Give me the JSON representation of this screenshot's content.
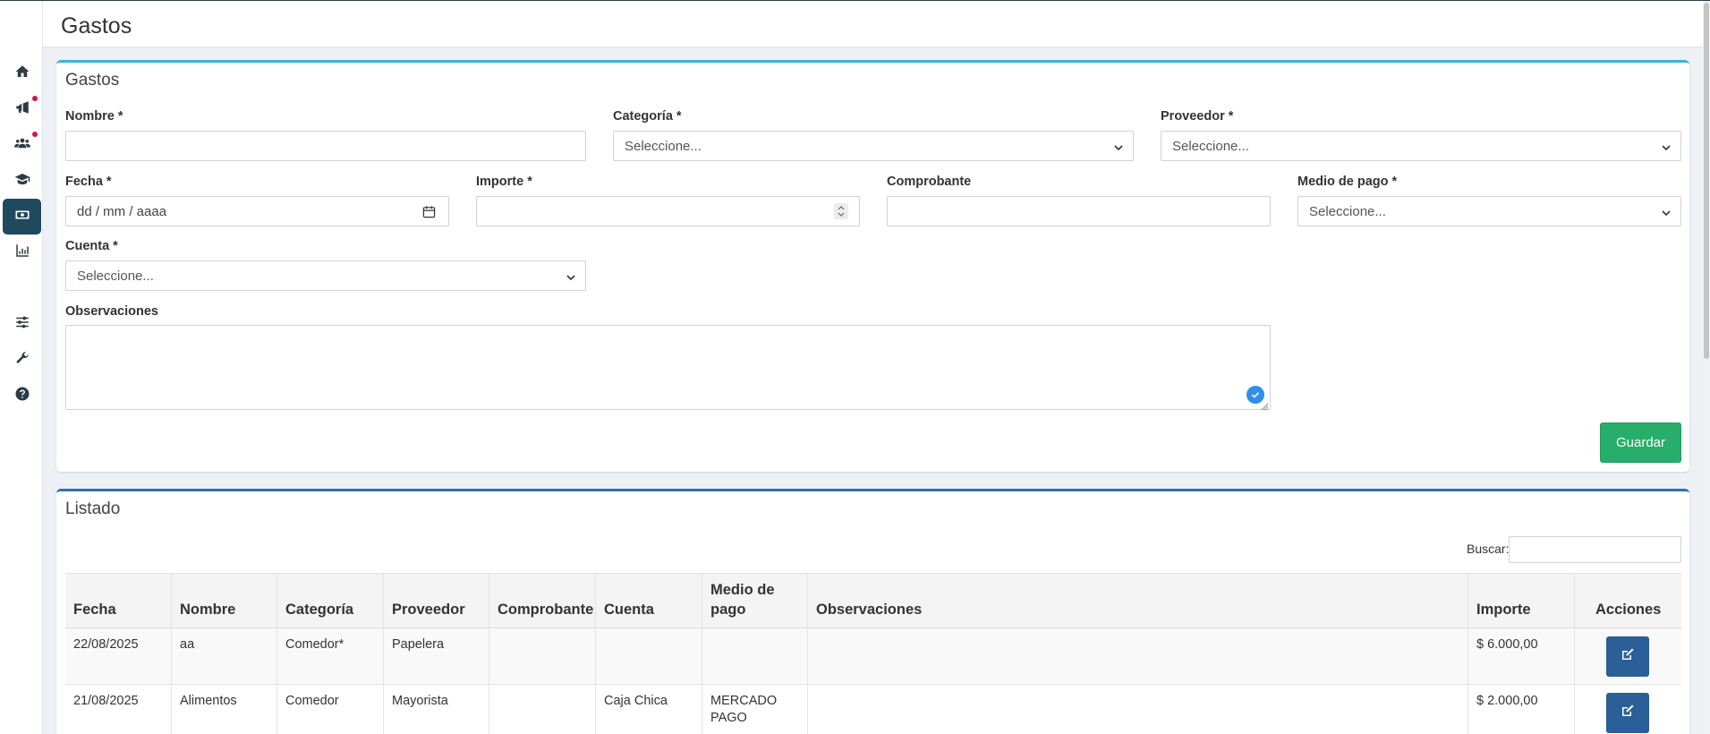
{
  "header": {
    "title": "Gastos"
  },
  "sidebar": {
    "items": [
      {
        "name": "home-icon"
      },
      {
        "name": "megaphone-icon",
        "notification": true
      },
      {
        "name": "users-icon",
        "notification": true
      },
      {
        "name": "graduation-cap-icon"
      },
      {
        "name": "money-icon",
        "active": true
      },
      {
        "name": "chart-icon"
      },
      {
        "name": "sliders-icon"
      },
      {
        "name": "wrench-icon"
      },
      {
        "name": "help-icon"
      }
    ]
  },
  "form": {
    "title": "Gastos",
    "nombre_label": "Nombre *",
    "nombre_value": "",
    "categoria_label": "Categoría *",
    "categoria_value": "Seleccione...",
    "proveedor_label": "Proveedor *",
    "proveedor_value": "Seleccione...",
    "fecha_label": "Fecha *",
    "fecha_placeholder": "dd / mm / aaaa",
    "importe_label": "Importe *",
    "comprobante_label": "Comprobante",
    "medio_pago_label": "Medio de pago *",
    "medio_pago_value": "Seleccione...",
    "cuenta_label": "Cuenta *",
    "cuenta_value": "Seleccione...",
    "observaciones_label": "Observaciones",
    "save_label": "Guardar"
  },
  "listado": {
    "title": "Listado",
    "search_label": "Buscar:",
    "columns": [
      "Fecha",
      "Nombre",
      "Categoría",
      "Proveedor",
      "Comprobante",
      "Cuenta",
      "Medio de pago",
      "Observaciones",
      "Importe",
      "Acciones"
    ],
    "rows": [
      {
        "fecha": "22/08/2025",
        "nombre": "aa",
        "categoria": "Comedor*",
        "proveedor": "Papelera",
        "comprobante": "",
        "cuenta": "",
        "medio_pago": "",
        "observaciones": "",
        "importe": "$ 6.000,00"
      },
      {
        "fecha": "21/08/2025",
        "nombre": "Alimentos",
        "categoria": "Comedor",
        "proveedor": "Mayorista",
        "comprobante": "",
        "cuenta": "Caja Chica",
        "medio_pago": "MERCADO PAGO",
        "observaciones": "",
        "importe": "$ 2.000,00"
      }
    ]
  },
  "colors": {
    "accent": "#1f4a5e",
    "save": "#27ae6b",
    "edit": "#2a5f97",
    "card_top": "#3bb3d9",
    "notification": "#d6134a"
  }
}
